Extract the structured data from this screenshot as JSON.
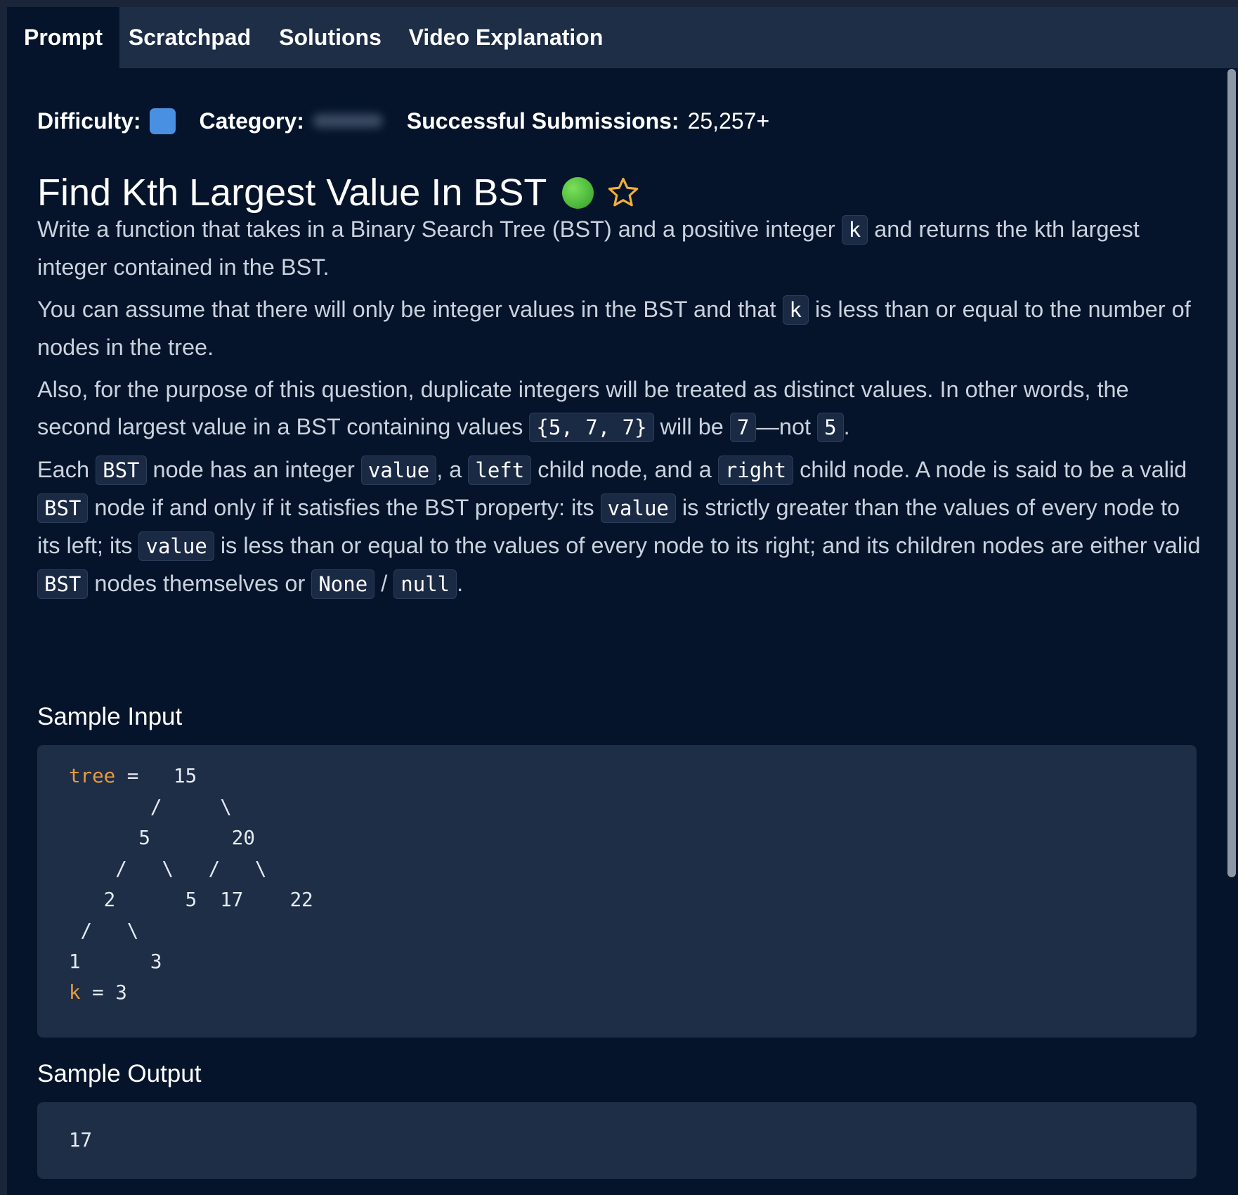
{
  "tabs": [
    "Prompt",
    "Scratchpad",
    "Solutions",
    "Video Explanation"
  ],
  "meta": {
    "difficulty_label": "Difficulty:",
    "category_label": "Category:",
    "submissions_label": "Successful Submissions:",
    "submissions_value": "25,257+"
  },
  "title": "Find Kth Largest Value In BST",
  "colors": {
    "difficulty": "#4a90e2",
    "status_dot": "#3fb832",
    "star": "#f0b03a",
    "keyword": "#e89b3c"
  },
  "paragraphs": {
    "p1": {
      "t1": "Write a function that takes in a Binary Search Tree (BST) and a positive integer ",
      "c1": "k",
      "t2": " and returns the kth largest integer contained in the BST."
    },
    "p2": {
      "t1": "You can assume that there will only be integer values in the BST and that ",
      "c1": "k",
      "t2": " is less than or equal to the number of nodes in the tree."
    },
    "p3": {
      "t1": "Also, for the purpose of this question, duplicate integers will be treated as distinct values. In other words, the second largest value in a BST containing values ",
      "c1": "{5, 7, 7}",
      "t2": " will be ",
      "c2": "7",
      "t3": "—not ",
      "c3": "5",
      "t4": "."
    },
    "p4": {
      "t1": "Each ",
      "c1": "BST",
      "t2": " node has an integer ",
      "c2": "value",
      "t3": ", a ",
      "c3": "left",
      "t4": " child node, and a ",
      "c4": "right",
      "t5": " child node. A node is said to be a valid ",
      "c5": "BST",
      "t6": " node if and only if it satisfies the BST property: its ",
      "c6": "value",
      "t7": " is strictly greater than the values of every node to its left; its ",
      "c7": "value",
      "t8": " is less than or equal to the values of every node to its right; and its children nodes are either valid ",
      "c8": "BST",
      "t9": " nodes themselves or ",
      "c9": "None",
      "t10": " / ",
      "c10": "null",
      "t11": "."
    }
  },
  "sample_input": {
    "heading": "Sample Input",
    "tree_kw": "tree",
    "tree_line": " =   15",
    "lines": [
      "       /     \\",
      "      5       20",
      "    /   \\   /   \\",
      "   2      5  17    22",
      " /   \\",
      "1      3"
    ],
    "k_kw": "k",
    "k_line": " = 3"
  },
  "sample_output": {
    "heading": "Sample Output",
    "value": "17"
  }
}
